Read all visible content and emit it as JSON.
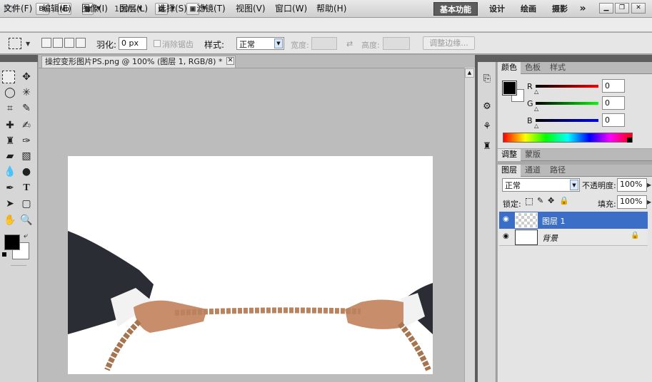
{
  "appbar": {
    "logo": "Ps",
    "zoom": "100%",
    "workspaces": [
      "基本功能",
      "设计",
      "绘画",
      "摄影"
    ],
    "more": "»"
  },
  "menu": [
    "文件(F)",
    "编辑(E)",
    "图像(I)",
    "图层(L)",
    "选择(S)",
    "滤镜(T)",
    "视图(V)",
    "窗口(W)",
    "帮助(H)"
  ],
  "options": {
    "feather_label": "羽化:",
    "feather_value": "0 px",
    "antialias_label": "消除锯齿",
    "style_label": "样式:",
    "style_value": "正常",
    "width_label": "宽度:",
    "height_label": "高度:",
    "refine_button": "调整边缘..."
  },
  "document": {
    "tab_title": "操控变形图片PS.png @ 100% (图层 1, RGB/8) *"
  },
  "color_panel": {
    "tabs": [
      "颜色",
      "色板",
      "样式"
    ],
    "r_label": "R",
    "g_label": "G",
    "b_label": "B",
    "r": "0",
    "g": "0",
    "b": "0"
  },
  "adjust_panel": {
    "tabs": [
      "调整",
      "蒙版"
    ]
  },
  "layers_panel": {
    "tabs": [
      "图层",
      "通道",
      "路径"
    ],
    "blend_mode": "正常",
    "opacity_label": "不透明度:",
    "opacity": "100%",
    "lock_label": "锁定:",
    "fill_label": "填充:",
    "fill": "100%",
    "layers": [
      {
        "name": "图层 1",
        "selected": true
      },
      {
        "name": "背景",
        "locked": true
      }
    ]
  },
  "colors": {
    "selection": "#3b6fc7",
    "fg": "#000000",
    "bg": "#ffffff"
  }
}
